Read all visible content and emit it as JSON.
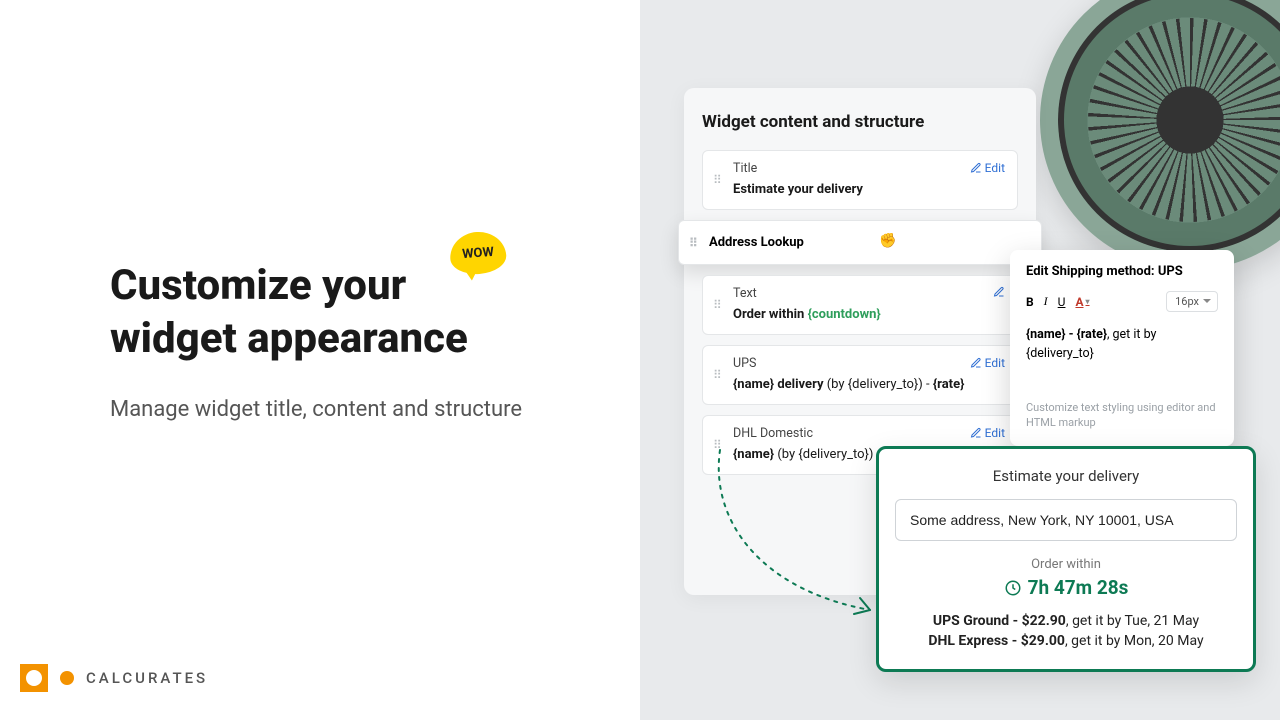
{
  "left": {
    "wow": "WOW",
    "headline": "Customize your widget appearance",
    "subtitle": "Manage widget title, content and structure"
  },
  "brand": {
    "name": "CALCURATES"
  },
  "panel": {
    "title": "Widget content and structure",
    "edit": "Edit",
    "items": {
      "title": {
        "label": "Title",
        "value": "Estimate your delivery"
      },
      "address": {
        "label": "Address Lookup"
      },
      "text": {
        "label": "Text",
        "prefix": "Order within ",
        "token": "{countdown}"
      },
      "ups": {
        "label": "UPS",
        "strong1": "{name} delivery",
        "plain": " (by {delivery_to}) - ",
        "strong2": "{rate}"
      },
      "dhl": {
        "label": "DHL Domestic",
        "strong1": "{name}",
        "plain": " (by {delivery_to})"
      }
    }
  },
  "editcard": {
    "title": "Edit Shipping method: UPS",
    "size": "16px",
    "body_strong": "{name} - {rate}",
    "body_plain": ", get it by {delivery_to}",
    "note": "Customize text styling using editor and HTML markup"
  },
  "preview": {
    "title": "Estimate your delivery",
    "address": "Some address, New York, NY 10001, USA",
    "order_label": "Order within",
    "timer": "7h 47m 28s",
    "line1_strong": "UPS Ground - $22.90",
    "line1_plain": ", get it by Tue, 21 May",
    "line2_strong": "DHL Express - $29.00",
    "line2_plain": ", get it by Mon, 20 May"
  }
}
